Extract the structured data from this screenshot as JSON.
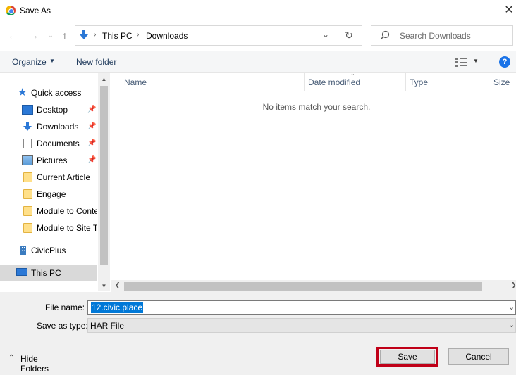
{
  "window": {
    "title": "Save As",
    "close_glyph": "✕"
  },
  "address": {
    "breadcrumb": [
      "This PC",
      "Downloads"
    ],
    "separator": "›",
    "search_placeholder": "Search Downloads"
  },
  "toolbar": {
    "organize": "Organize",
    "new_folder": "New folder",
    "help": "?"
  },
  "nav": {
    "quick_access": "Quick access",
    "items": [
      {
        "label": "Desktop",
        "icon": "desktop-icon",
        "pinned": true
      },
      {
        "label": "Downloads",
        "icon": "download-arrow-icon",
        "pinned": true
      },
      {
        "label": "Documents",
        "icon": "documents-icon",
        "pinned": true
      },
      {
        "label": "Pictures",
        "icon": "pictures-icon",
        "pinned": true
      },
      {
        "label": "Current Article",
        "icon": "folder-icon",
        "pinned": false
      },
      {
        "label": "Engage",
        "icon": "folder-icon",
        "pinned": false
      },
      {
        "label": "Module to Content",
        "icon": "folder-icon",
        "pinned": false
      },
      {
        "label": "Module to Site T",
        "icon": "folder-icon",
        "pinned": false
      }
    ],
    "civicplus": "CivicPlus",
    "this_pc": "This PC"
  },
  "columns": [
    "Name",
    "Date modified",
    "Type",
    "Size"
  ],
  "empty_message": "No items match your search.",
  "form": {
    "filename_label": "File name:",
    "filename_value": "12.civic.place",
    "savetype_label": "Save as type:",
    "savetype_value": "HAR File"
  },
  "footer": {
    "hide_folders": "Hide Folders",
    "save": "Save",
    "cancel": "Cancel"
  },
  "colors": {
    "accent": "#0078d7",
    "highlight_outline": "#c00018",
    "help_blue": "#1a73e8"
  }
}
